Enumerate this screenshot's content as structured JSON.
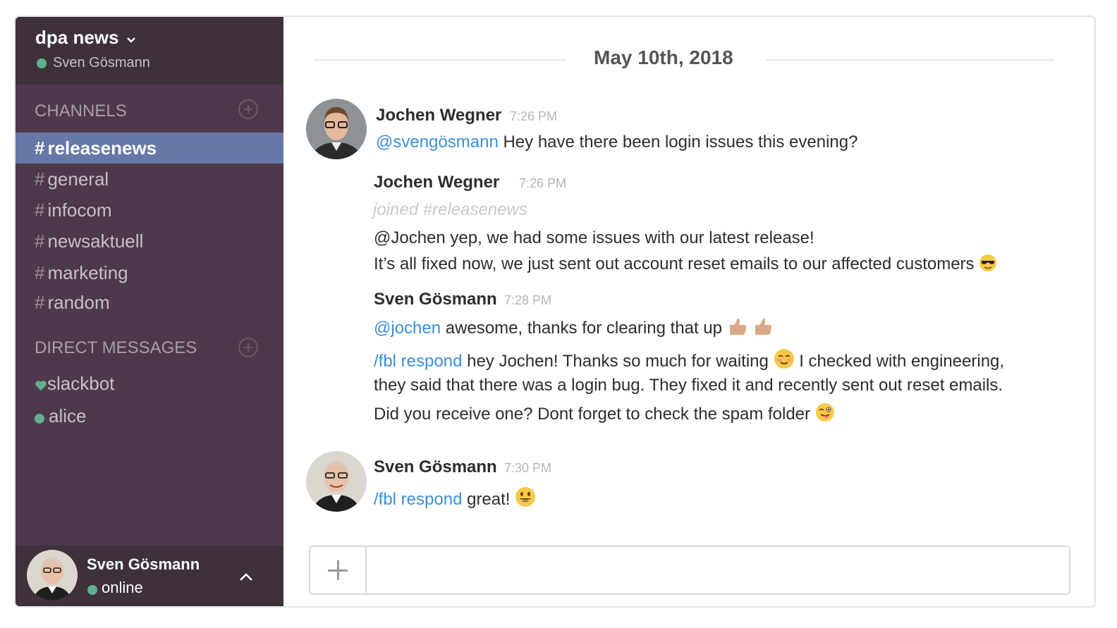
{
  "sidebar": {
    "team_name": "dpa news",
    "team_user": "Sven Gösmann",
    "channels_title": "CHANNELS",
    "channels": [
      {
        "hash": "#",
        "name": "releasenews",
        "active": true
      },
      {
        "hash": "#",
        "name": "general"
      },
      {
        "hash": "#",
        "name": "infocom"
      },
      {
        "hash": "#",
        "name": "newsaktuell"
      },
      {
        "hash": "#",
        "name": "marketing"
      },
      {
        "hash": "#",
        "name": "random"
      }
    ],
    "dm_title": "DIRECT MESSAGES",
    "dms": [
      {
        "name": "slackbot",
        "icon": "heart-icon"
      },
      {
        "name": "alice",
        "icon": "presence-dot"
      }
    ],
    "footer": {
      "name": "Sven Gösmann",
      "status": "online"
    }
  },
  "colors": {
    "sidebar_bg": "#4d394b",
    "active_channel": "#6578a8",
    "mention": "#3b8fd9",
    "presence": "#5fb08f"
  },
  "main": {
    "date": "May 10th, 2018",
    "messages": [
      {
        "author": "Jochen Wegner",
        "time": "7:26 PM",
        "mention": "@svengösmann",
        "text": " Hey have there been login issues this evening?"
      },
      {
        "author": "Jochen Wegner",
        "time": "7:26 PM",
        "note": "joined #releasenews",
        "line1": "@Jochen yep, we had some issues with our latest release!",
        "line2": "It’s all fixed now, we just sent out account reset emails to our affected customers"
      },
      {
        "author": "Sven Gösmann",
        "time": "7:28 PM",
        "line1_mention": "@jochen",
        "line1_text": " awesome, thanks for clearing that up",
        "line2_mention": "/fbl respond",
        "line2_text": " hey Jochen! Thanks so much for waiting",
        "line2_text_b": " I checked with engineering,",
        "line3": "they said that there was a login bug. They fixed it and recently sent out reset emails.",
        "line4": "Did you receive one? Dont forget to check the spam folder"
      },
      {
        "author": "Sven Gösmann",
        "time": "7:30 PM",
        "mention": "/fbl respond",
        "text": " great!"
      }
    ]
  },
  "composer": {
    "placeholder": ""
  }
}
